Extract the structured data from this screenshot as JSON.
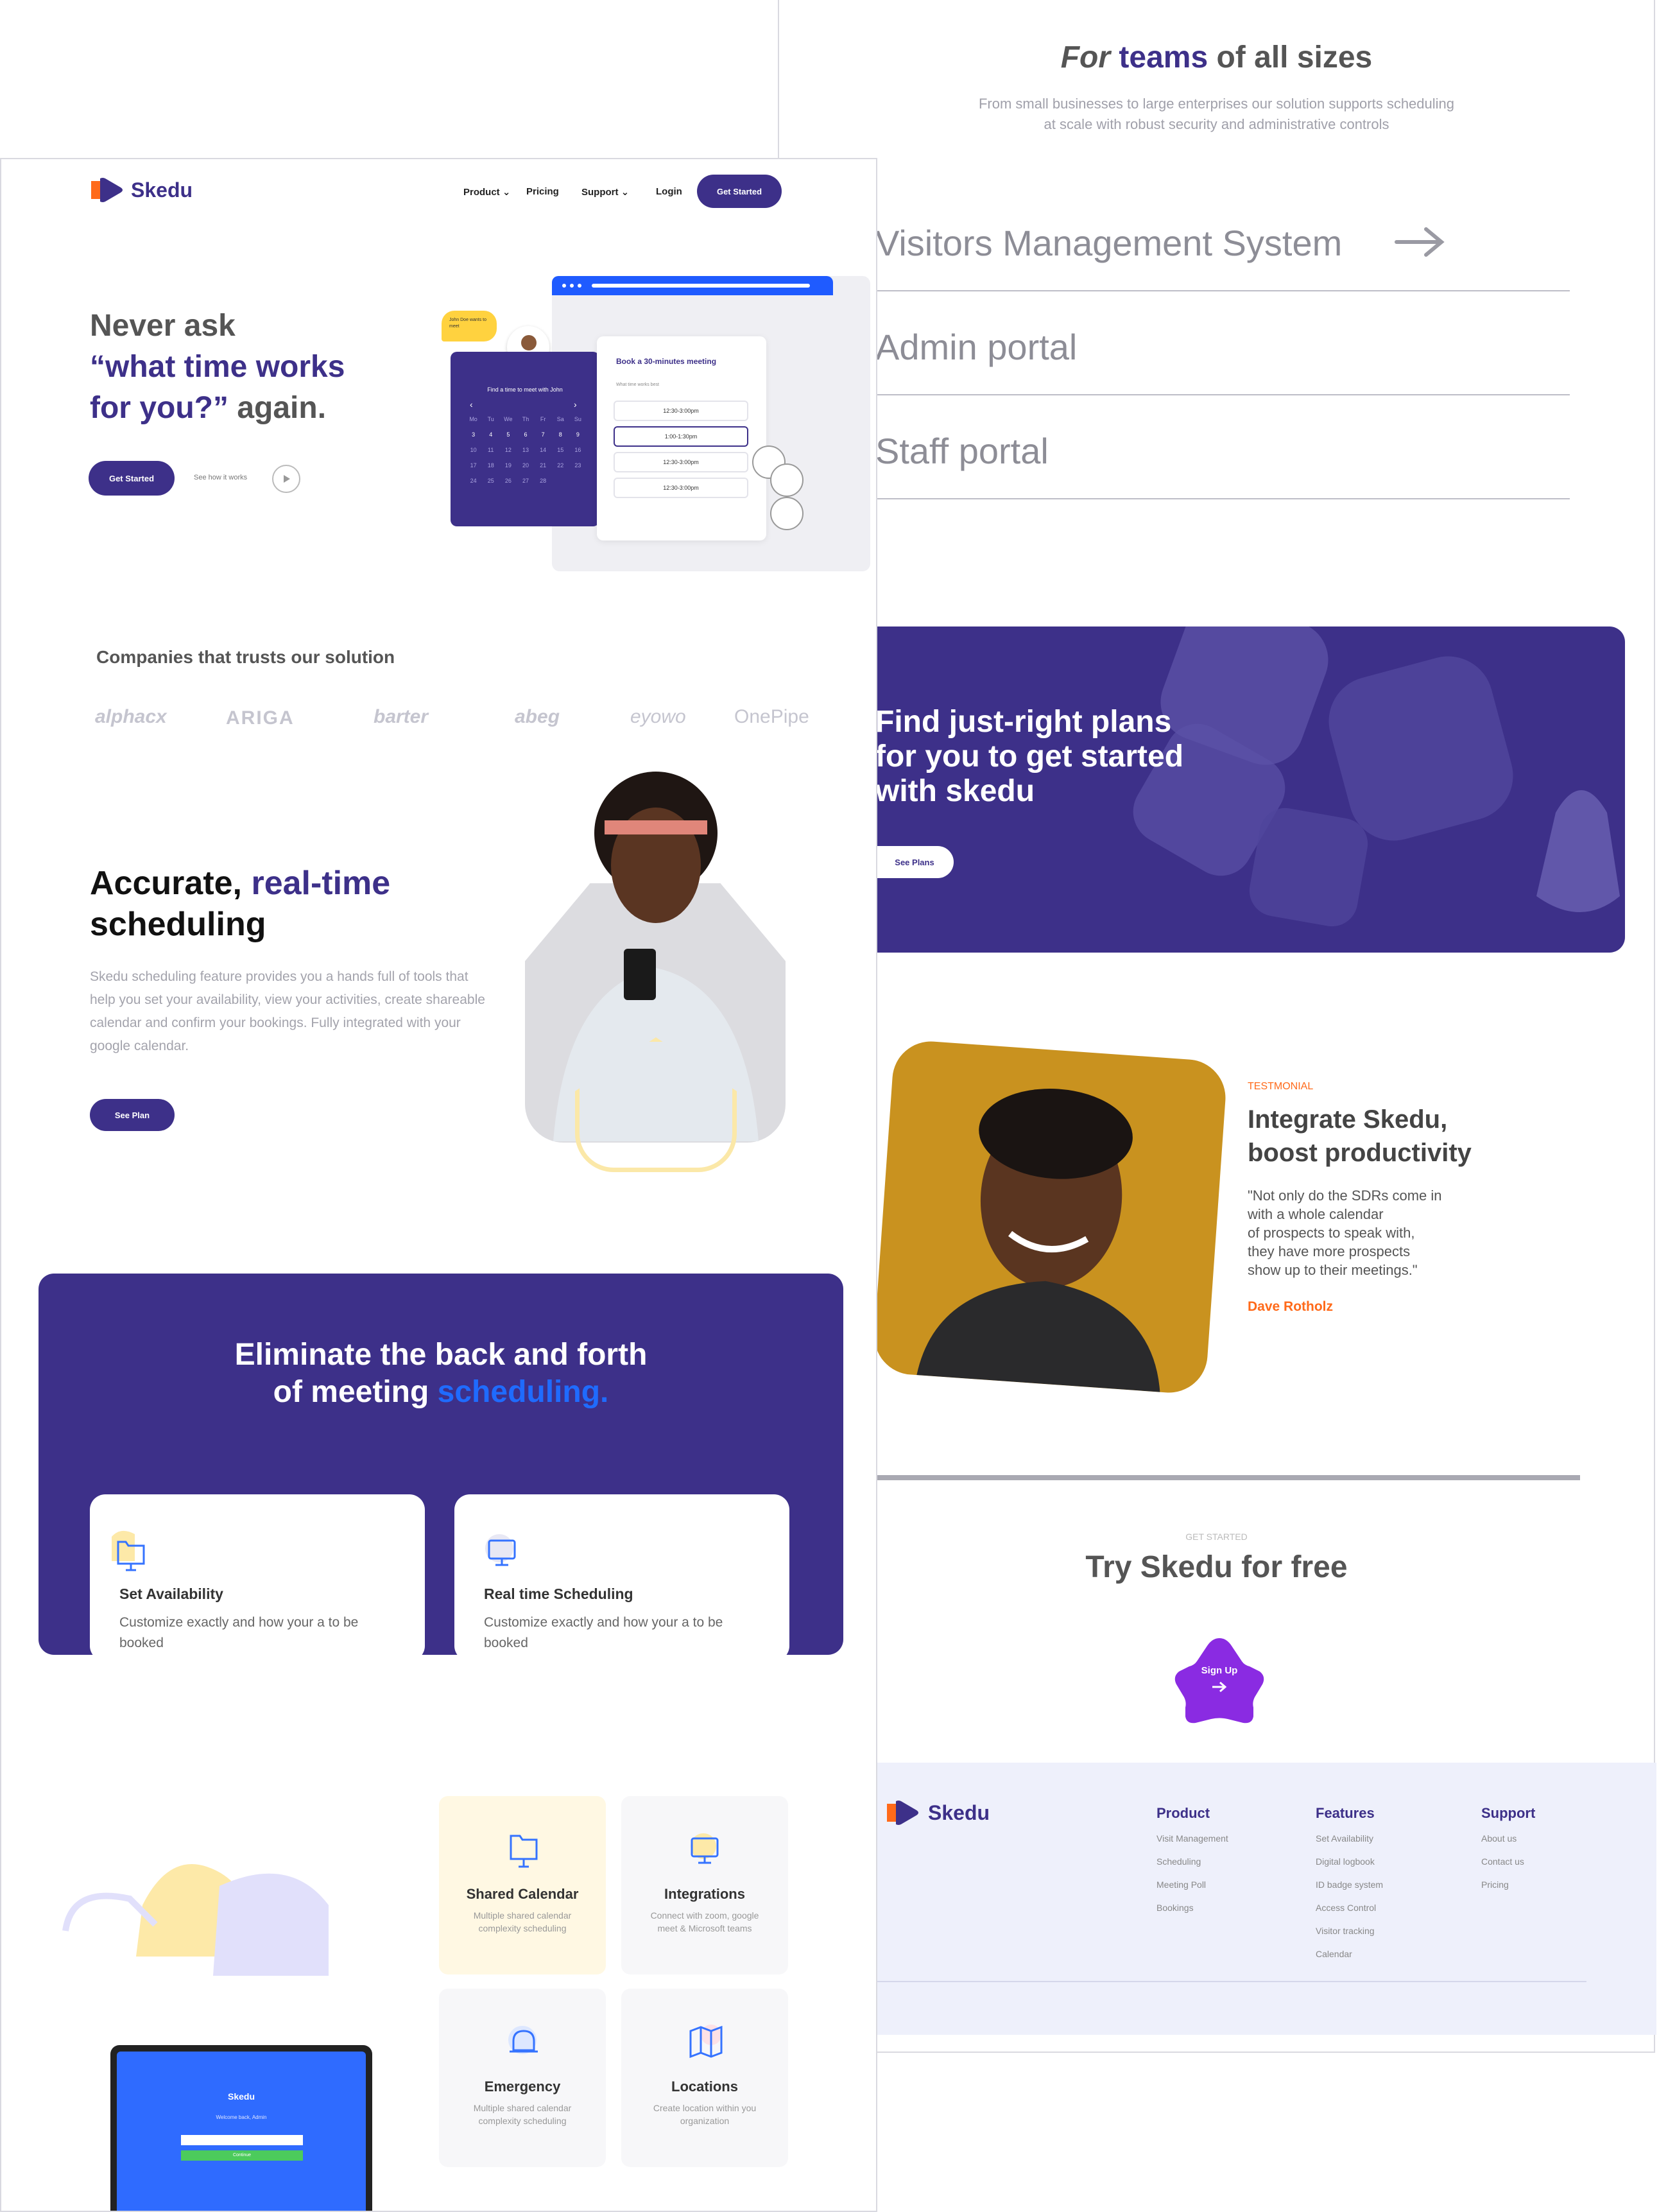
{
  "brand": {
    "name": "Skedu",
    "accent": "#3d3089",
    "highlight": "#1f6bff",
    "logo_orange": "#ff6a1a"
  },
  "nav": {
    "product": "Product",
    "pricing": "Pricing",
    "support": "Support",
    "login": "Login",
    "cta": "Get Started"
  },
  "hero": {
    "line1": "Never ask",
    "line2": "“what time works",
    "line3a": "for you?”",
    "line3b": " again.",
    "cta": "Get Started",
    "secondary": "See how it works"
  },
  "widget": {
    "bubble": "John Doe wants to meet",
    "calendar_title": "Find a time to meet with John",
    "weekdays": [
      "Mo",
      "Tu",
      "We",
      "Th",
      "Fr",
      "Sa",
      "Su"
    ],
    "rows": [
      [
        "3",
        "4",
        "5",
        "6",
        "7",
        "8",
        "9"
      ],
      [
        "10",
        "11",
        "12",
        "13",
        "14",
        "15",
        "16"
      ],
      [
        "17",
        "18",
        "19",
        "20",
        "21",
        "22",
        "23"
      ],
      [
        "24",
        "25",
        "26",
        "27",
        "28",
        "",
        ""
      ]
    ],
    "booking_title": "Book a 30-minutes meeting",
    "booking_sub": "What time works best",
    "slots": [
      "12:30-3:00pm",
      "1:00-1:30pm",
      "12:30-3:00pm",
      "12:30-3:00pm"
    ]
  },
  "companies": {
    "title": "Companies that trusts our solution",
    "logos": [
      "alphacx",
      "ARIGA",
      "barter",
      "abeg",
      "eyowo",
      "OnePipe"
    ]
  },
  "feature": {
    "title_a": "Accurate, ",
    "title_b": "real-time",
    "title_c": "scheduling",
    "body": "Skedu scheduling feature provides you a hands full of tools that help you set your availability, view your activities, create shareable calendar and confirm your bookings. Fully integrated with your google calendar.",
    "cta": "See Plan"
  },
  "eliminate": {
    "line1": "Eliminate the back and forth",
    "line2a": "of meeting ",
    "line2b": "scheduling.",
    "cards": [
      {
        "title": "Set Availability",
        "text": "Customize exactly and how your a to be booked",
        "icon": "folder-icon"
      },
      {
        "title": "Real time Scheduling",
        "text": "Customize exactly and how your a to be booked",
        "icon": "monitor-icon"
      }
    ]
  },
  "tiles": [
    {
      "title": "Shared Calendar",
      "text": "Multiple shared calendar complexity scheduling",
      "icon": "folder-icon"
    },
    {
      "title": "Integrations",
      "text": "Connect with zoom, google meet & Microsoft teams",
      "icon": "monitor-icon"
    },
    {
      "title": "Emergency",
      "text": "Multiple shared calendar complexity scheduling",
      "icon": "alarm-icon"
    },
    {
      "title": "Locations",
      "text": "Create location within you organization",
      "icon": "map-icon"
    }
  ],
  "laptop": {
    "brand": "Skedu",
    "welcome": "Welcome back, Admin",
    "button": "Continue"
  },
  "teams": {
    "title_a": "For",
    "title_b": " teams ",
    "title_c": "of all sizes",
    "sub1": "From small businesses to large enterprises our solution supports scheduling",
    "sub2": "at scale with robust security and administrative controls",
    "solutions": [
      "Visitors Management System",
      "Admin portal",
      "Staff portal"
    ]
  },
  "plans": {
    "line1": "Find just-right plans",
    "line2": "for you to get started",
    "line3": "with skedu",
    "cta": "See Plans"
  },
  "testimonial": {
    "kicker": "TESTMONIAL",
    "title1": "Integrate Skedu,",
    "title2": "boost productivity",
    "quote": [
      "\"Not only do the SDRs come in",
      "with a whole calendar",
      "of prospects to speak with,",
      "they have more prospects",
      "show up to their meetings.\""
    ],
    "author": "Dave Rotholz"
  },
  "signup": {
    "kicker": "GET STARTED",
    "title": "Try Skedu for free",
    "cta": "Sign Up"
  },
  "footer": {
    "brand": "Skedu",
    "cols": [
      {
        "head": "Product",
        "items": [
          "Visit Management",
          "Scheduling",
          "Meeting Poll",
          "Bookings"
        ]
      },
      {
        "head": "Features",
        "items": [
          "Set Availability",
          "Digital logbook",
          "ID badge system",
          "Access Control",
          "Visitor tracking",
          "Calendar"
        ]
      },
      {
        "head": "Support",
        "items": [
          "About us",
          "Contact us",
          "Pricing"
        ]
      }
    ]
  }
}
